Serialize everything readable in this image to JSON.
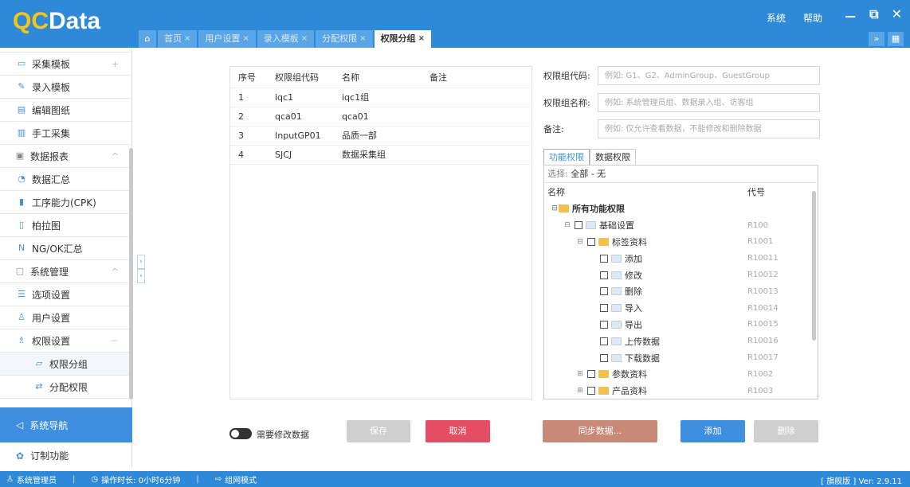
{
  "header": {
    "logo_main": "Data",
    "logo_prefix": "QC",
    "links": [
      "系统",
      "帮助"
    ],
    "window_controls": [
      "－",
      "⧉",
      "✕"
    ]
  },
  "tabs": [
    {
      "label": "首页",
      "active": false
    },
    {
      "label": "用户设置",
      "active": false
    },
    {
      "label": "录入模板",
      "active": false
    },
    {
      "label": "分配权限",
      "active": false
    },
    {
      "label": "权限分组",
      "active": true
    }
  ],
  "sidebar": {
    "items": [
      {
        "label": "采集模板",
        "icon": "template-icon",
        "tail": "+"
      },
      {
        "label": "录入模板",
        "icon": "pen-icon",
        "tail": ""
      },
      {
        "label": "编辑图纸",
        "icon": "drawing-icon",
        "tail": ""
      },
      {
        "label": "手工采集",
        "icon": "manual-icon",
        "tail": ""
      },
      {
        "label": "数据报表",
        "icon": "report-icon",
        "tail": "^",
        "group": true
      },
      {
        "label": "数据汇总",
        "icon": "pie-icon",
        "tail": ""
      },
      {
        "label": "工序能力(CPK)",
        "icon": "bar-icon",
        "tail": ""
      },
      {
        "label": "柏拉图",
        "icon": "pareto-icon",
        "tail": ""
      },
      {
        "label": "NG/OK汇总",
        "icon": "ng-icon",
        "tail": ""
      },
      {
        "label": "系统管理",
        "icon": "system-icon",
        "tail": "^",
        "group": true
      },
      {
        "label": "选项设置",
        "icon": "list-icon",
        "tail": ""
      },
      {
        "label": "用户设置",
        "icon": "user-icon",
        "tail": ""
      },
      {
        "label": "权限设置",
        "icon": "users-icon",
        "tail": "－"
      },
      {
        "label": "权限分组",
        "icon": "group-icon",
        "tail": "",
        "sub": true,
        "active": true
      },
      {
        "label": "分配权限",
        "icon": "assign-icon",
        "tail": "",
        "sub": true
      }
    ],
    "nav_label": "系统导航",
    "custom_label": "订制功能"
  },
  "table": {
    "headers": [
      "序号",
      "权限组代码",
      "名称",
      "备注"
    ],
    "rows": [
      [
        "1",
        "iqc1",
        "iqc1组",
        ""
      ],
      [
        "2",
        "qca01",
        "qca01",
        ""
      ],
      [
        "3",
        "InputGP01",
        "品质一部",
        ""
      ],
      [
        "4",
        "SJCJ",
        "数据采集组",
        ""
      ]
    ]
  },
  "form": {
    "code_label": "权限组代码:",
    "code_placeholder": "例如: G1、G2、AdminGroup、GuestGroup",
    "name_label": "权限组名称:",
    "name_placeholder": "例如: 系统管理员组、数据录入组、访客组",
    "note_label": "备注:",
    "note_placeholder": "例如: 仅允许查看数据，不能修改和删除数据"
  },
  "perm_tabs": [
    "功能权限",
    "数据权限"
  ],
  "tree": {
    "select_label": "选择:",
    "select_all": "全部",
    "select_none": "- 无",
    "col_name": "名称",
    "col_code": "代号",
    "rows": [
      {
        "label": "所有功能权限",
        "code": "",
        "level": 0,
        "folder": "open",
        "checkbox": false,
        "toggle": "⊟"
      },
      {
        "label": "基础设置",
        "code": "R100",
        "level": 1,
        "folder": "doc",
        "checkbox": true,
        "toggle": "⊟"
      },
      {
        "label": "标签资料",
        "code": "R1001",
        "level": 2,
        "folder": "open",
        "checkbox": true,
        "toggle": "⊟"
      },
      {
        "label": "添加",
        "code": "R10011",
        "level": 3,
        "folder": "doc",
        "checkbox": true,
        "toggle": ""
      },
      {
        "label": "修改",
        "code": "R10012",
        "level": 3,
        "folder": "doc",
        "checkbox": true,
        "toggle": ""
      },
      {
        "label": "删除",
        "code": "R10013",
        "level": 3,
        "folder": "doc",
        "checkbox": true,
        "toggle": ""
      },
      {
        "label": "导入",
        "code": "R10014",
        "level": 3,
        "folder": "doc",
        "checkbox": true,
        "toggle": ""
      },
      {
        "label": "导出",
        "code": "R10015",
        "level": 3,
        "folder": "doc",
        "checkbox": true,
        "toggle": ""
      },
      {
        "label": "上传数据",
        "code": "R10016",
        "level": 3,
        "folder": "doc",
        "checkbox": true,
        "toggle": ""
      },
      {
        "label": "下载数据",
        "code": "R10017",
        "level": 3,
        "folder": "doc",
        "checkbox": true,
        "toggle": ""
      },
      {
        "label": "参数资料",
        "code": "R1002",
        "level": 2,
        "folder": "open",
        "checkbox": true,
        "toggle": "⊞"
      },
      {
        "label": "产品资料",
        "code": "R1003",
        "level": 2,
        "folder": "open",
        "checkbox": true,
        "toggle": "⊞"
      }
    ]
  },
  "buttons": {
    "toggle_label": "需要修改数据",
    "save": "保存",
    "cancel": "取消",
    "sync": "同步数据...",
    "add": "添加",
    "delete": "删除"
  },
  "status": {
    "user": "系统管理员",
    "duration": "操作时长: 0小时6分钟",
    "mode": "组网模式",
    "version": "[ 旗舰版 ] Ver: 2.9.11"
  }
}
